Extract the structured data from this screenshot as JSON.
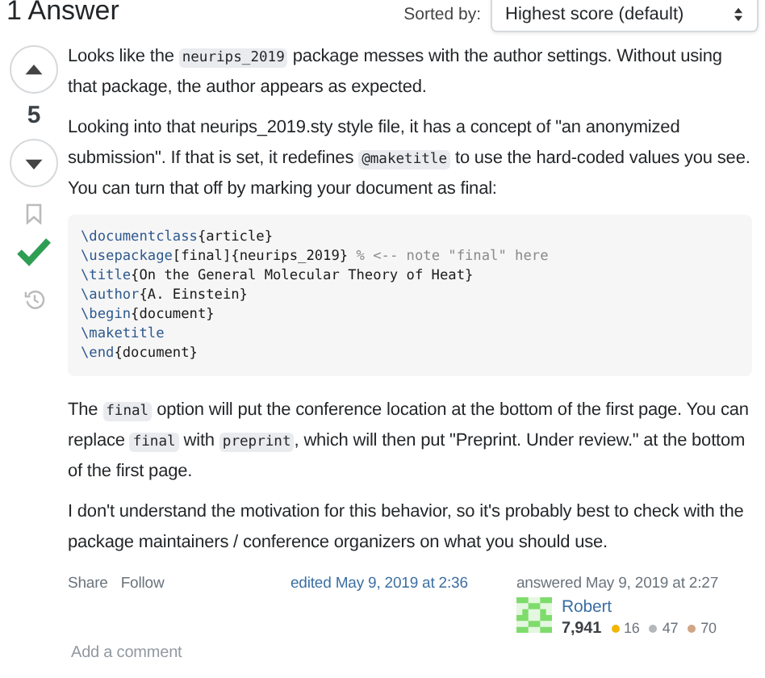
{
  "header": {
    "title": "1 Answer",
    "sort_label": "Sorted by:",
    "sort_value": "Highest score (default)"
  },
  "votes": {
    "score": "5",
    "bookmarked": false,
    "accepted": true
  },
  "paragraphs": [
    [
      {
        "kind": "text",
        "text": "Looks like the "
      },
      {
        "kind": "code",
        "text": "neurips_2019"
      },
      {
        "kind": "text",
        "text": " package messes with the author settings. Without using that package, the author appears as expected."
      }
    ],
    [
      {
        "kind": "text",
        "text": "Looking into that neurips_2019.sty style file, it has a concept of \"an anonymized submission\". If that is set, it redefines "
      },
      {
        "kind": "code",
        "text": "@maketitle"
      },
      {
        "kind": "text",
        "text": " to use the hard-coded values you see. You can turn that off by marking your document as final:"
      }
    ]
  ],
  "code_block": [
    [
      {
        "kind": "cmd",
        "text": "\\documentclass"
      },
      {
        "kind": "text",
        "text": "{article}"
      }
    ],
    [
      {
        "kind": "cmd",
        "text": "\\usepackage"
      },
      {
        "kind": "text",
        "text": "[final]{neurips_2019} "
      },
      {
        "kind": "comment",
        "text": "% <-- note \"final\" here"
      }
    ],
    [
      {
        "kind": "cmd",
        "text": "\\title"
      },
      {
        "kind": "text",
        "text": "{On the General Molecular Theory of Heat}"
      }
    ],
    [
      {
        "kind": "cmd",
        "text": "\\author"
      },
      {
        "kind": "text",
        "text": "{A. Einstein}"
      }
    ],
    [
      {
        "kind": "cmd",
        "text": "\\begin"
      },
      {
        "kind": "text",
        "text": "{document}"
      }
    ],
    [
      {
        "kind": "cmd",
        "text": "\\maketitle"
      }
    ],
    [
      {
        "kind": "cmd",
        "text": "\\end"
      },
      {
        "kind": "text",
        "text": "{document}"
      }
    ]
  ],
  "paragraphs_after": [
    [
      {
        "kind": "text",
        "text": "The "
      },
      {
        "kind": "code",
        "text": "final"
      },
      {
        "kind": "text",
        "text": " option will put the conference location at the bottom of the first page. You can replace "
      },
      {
        "kind": "code",
        "text": "final"
      },
      {
        "kind": "text",
        "text": " with "
      },
      {
        "kind": "code",
        "text": "preprint"
      },
      {
        "kind": "text",
        "text": ", which will then put \"Preprint. Under review.\" at the bottom of the first page."
      }
    ],
    [
      {
        "kind": "text",
        "text": "I don't understand the motivation for this behavior, so it's probably best to check with the package maintainers / conference organizers on what you should use."
      }
    ]
  ],
  "actions": [
    "Share",
    "Follow"
  ],
  "edited": "edited May 9, 2019 at 2:36",
  "answered": {
    "label": "answered May 9, 2019 at 2:27",
    "user": "Robert",
    "reputation": "7,941",
    "badges": [
      {
        "count": "16",
        "color": "#f1b600"
      },
      {
        "count": "47",
        "color": "#b4b8bc"
      },
      {
        "count": "70",
        "color": "#d1a684"
      }
    ]
  },
  "add_comment": "Add a comment"
}
